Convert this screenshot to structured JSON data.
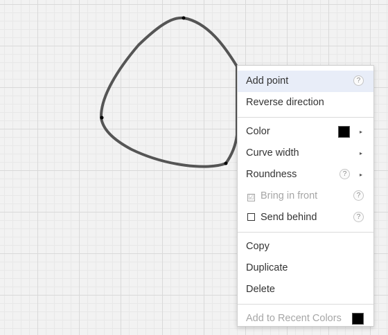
{
  "shape": {
    "stroke_color": "#555555",
    "point_color": "#000000"
  },
  "menu": {
    "items": [
      {
        "label": "Add point",
        "help": "?"
      },
      {
        "label": "Reverse direction"
      },
      {
        "label": "Color",
        "swatch": "#000000",
        "submenu": "▸"
      },
      {
        "label": "Curve width",
        "submenu": "▸"
      },
      {
        "label": "Roundness",
        "help": "?",
        "submenu": "▸"
      },
      {
        "label": "Bring in front",
        "check": "☑",
        "help": "?",
        "disabled": true
      },
      {
        "label": "Send behind",
        "check": "",
        "help": "?"
      },
      {
        "label": "Copy"
      },
      {
        "label": "Duplicate"
      },
      {
        "label": "Delete"
      },
      {
        "label": "Add to Recent Colors",
        "swatch": "#000000",
        "disabled": true
      }
    ]
  }
}
